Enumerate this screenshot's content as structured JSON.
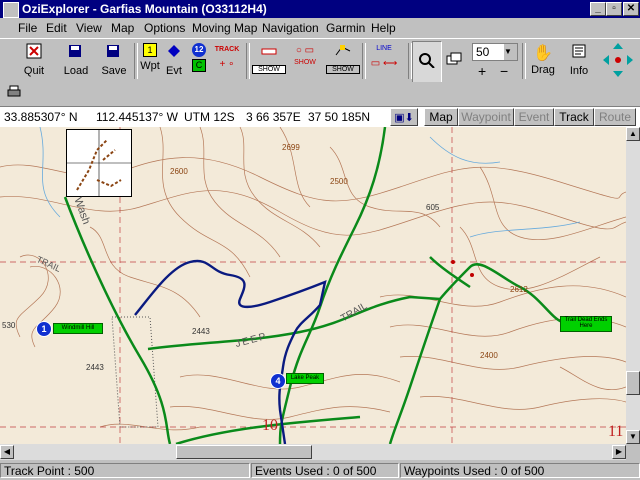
{
  "window": {
    "title": "OziExplorer - Garfias Mountain (O33112H4)"
  },
  "menu": [
    "File",
    "Edit",
    "View",
    "Map",
    "Options",
    "Moving Map",
    "Navigation",
    "Garmin",
    "Help"
  ],
  "toolbar": {
    "quit": "Quit",
    "load": "Load",
    "save": "Save",
    "wpt": "Wpt",
    "evt": "Evt",
    "track": "TRACK",
    "show": "SHOW",
    "line": "LINE",
    "zoom_value": "50",
    "drag": "Drag",
    "info": "Info",
    "wpt_num": "1",
    "evt_num": "12",
    "c_label": "C"
  },
  "coords": {
    "lat": "33.885307° N",
    "lon": "112.445137° W",
    "utm": "UTM  12S",
    "easting": "3 66 357E",
    "northing": "37 50 185N"
  },
  "tabs": {
    "map": "Map",
    "waypoint": "Waypoint",
    "event": "Event",
    "track": "Track",
    "route": "Route"
  },
  "map": {
    "labels": {
      "trail": "TRAIL",
      "jeep": "JEEP",
      "trail2": "TRAIL",
      "wash": "Wash",
      "e2600": "2600",
      "e2699": "2699",
      "e2443": "2443",
      "e2400": "2400",
      "e2500": "2500",
      "e530": "530",
      "e605": "605",
      "e2612": "2612",
      "e2443b": "2443",
      "grid10": "10",
      "grid11": "11"
    },
    "waypoints": [
      {
        "num": "1",
        "label": "Windmill Hill"
      },
      {
        "num": "4",
        "label": "Lake Peak"
      },
      {
        "num": "",
        "label": "Trail Dead Ends Here"
      }
    ],
    "colors": {
      "track": "#0a1a80",
      "trail": "#0a8a1a",
      "waypoint": "#1030d0",
      "contour": "#8b4513"
    }
  },
  "status": {
    "track_point": "Track Point : 500",
    "events": "Events Used : 0 of 500",
    "waypoints": "Waypoints Used : 0 of 500"
  }
}
